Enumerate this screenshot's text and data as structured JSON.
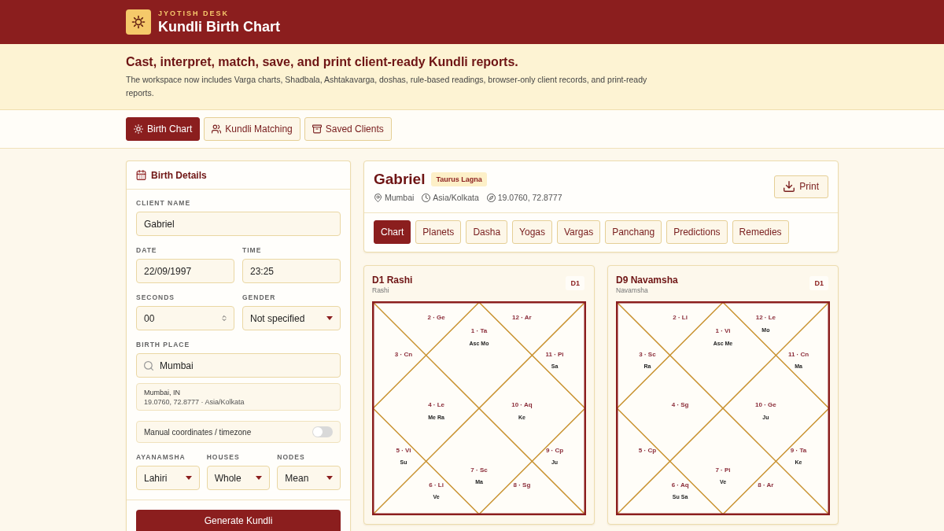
{
  "header": {
    "eyebrow": "JYOTISH DESK",
    "title": "Kundli Birth Chart"
  },
  "banner": {
    "heading": "Cast, interpret, match, save, and print client-ready Kundli reports.",
    "text": "The workspace now includes Varga charts, Shadbala, Ashtakavarga, doshas, rule-based readings, browser-only client records, and print-ready reports."
  },
  "main_tabs": [
    {
      "label": "Birth Chart",
      "selected": true
    },
    {
      "label": "Kundli Matching",
      "selected": false
    },
    {
      "label": "Saved Clients",
      "selected": false
    }
  ],
  "birth_details": {
    "title": "Birth Details",
    "client_name": {
      "label": "CLIENT NAME",
      "value": "Gabriel"
    },
    "date": {
      "label": "DATE",
      "value": "22/09/1997"
    },
    "time": {
      "label": "TIME",
      "value": "23:25"
    },
    "seconds": {
      "label": "SECONDS",
      "value": "00"
    },
    "gender": {
      "label": "GENDER",
      "value": "Not specified"
    },
    "birth_place": {
      "label": "BIRTH PLACE",
      "value": "Mumbai"
    },
    "place_result": {
      "name": "Mumbai, IN",
      "details": "19.0760, 72.8777 · Asia/Kolkata"
    },
    "manual_toggle": {
      "label": "Manual coordinates / timezone",
      "on": false
    },
    "settings": [
      {
        "label": "AYANAMSHA",
        "value": "Lahiri"
      },
      {
        "label": "HOUSES",
        "value": "Whole"
      },
      {
        "label": "NODES",
        "value": "Mean"
      }
    ],
    "submit": "Generate Kundli"
  },
  "profile": {
    "name": "Gabriel",
    "badge": "Taurus Lagna",
    "meta": [
      {
        "kind": "place",
        "text": "Mumbai"
      },
      {
        "kind": "timezone",
        "text": "Asia/Kolkata"
      },
      {
        "kind": "coordinates",
        "text": "19.0760, 72.8777"
      }
    ],
    "print_button": "Print"
  },
  "chart_tabs": [
    {
      "label": "Chart",
      "selected": true
    },
    {
      "label": "Planets",
      "selected": false
    },
    {
      "label": "Dasha",
      "selected": false
    },
    {
      "label": "Yogas",
      "selected": false
    },
    {
      "label": "Vargas",
      "selected": false
    },
    {
      "label": "Panchang",
      "selected": false
    },
    {
      "label": "Predictions",
      "selected": false
    },
    {
      "label": "Remedies",
      "selected": false
    }
  ],
  "charts": [
    {
      "title": "D1 Rashi",
      "subtitle": "Rashi",
      "badge": "D1",
      "houses": [
        {
          "label": "1 · Ta",
          "planets": "Asc Mo"
        },
        {
          "label": "2 · Ge"
        },
        {
          "label": "3 · Cn"
        },
        {
          "label": "4 · Le",
          "planets": "Me Ra"
        },
        {
          "label": "5 · Vi",
          "planets": "Su"
        },
        {
          "label": "6 · Li",
          "planets": "Ve"
        },
        {
          "label": "7 · Sc",
          "planets": "Ma"
        },
        {
          "label": "8 · Sg"
        },
        {
          "label": "9 · Cp",
          "planets": "Ju"
        },
        {
          "label": "10 · Aq",
          "planets": "Ke"
        },
        {
          "label": "11 · Pi",
          "planets": "Sa"
        },
        {
          "label": "12 · Ar"
        }
      ]
    },
    {
      "title": "D9 Navamsha",
      "subtitle": "Navamsha",
      "badge": "D1",
      "houses": [
        {
          "label": "1 · Vi",
          "planets": "Asc Me"
        },
        {
          "label": "2 · Li"
        },
        {
          "label": "3 · Sc",
          "planets": "Ra"
        },
        {
          "label": "4 · Sg"
        },
        {
          "label": "5 · Cp"
        },
        {
          "label": "6 · Aq",
          "planets": "Su Sa"
        },
        {
          "label": "7 · Pi",
          "planets": "Ve"
        },
        {
          "label": "8 · Ar"
        },
        {
          "label": "9 · Ta",
          "planets": "Ke"
        },
        {
          "label": "10 · Ge",
          "planets": "Ju"
        },
        {
          "label": "11 · Cn",
          "planets": "Ma"
        },
        {
          "label": "12 · Le",
          "planets": "Mo"
        }
      ]
    }
  ]
}
